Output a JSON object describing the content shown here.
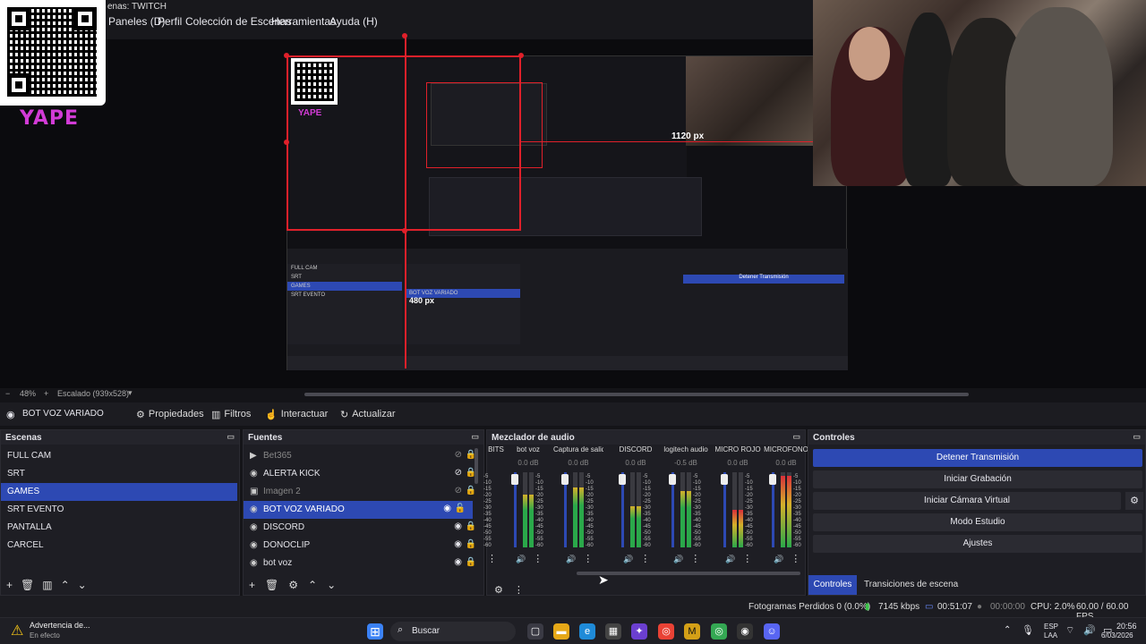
{
  "window": {
    "title": "enas: TWITCH"
  },
  "menu": [
    "Paneles (D)",
    "Perfil",
    "Colección de Escenas",
    "Herramientas",
    "Ayuda (H)"
  ],
  "overlay": {
    "yape_text": "YAPE"
  },
  "preview": {
    "dim_horizontal": "1120 px",
    "dim_inner": "480 px",
    "zoom": "48%",
    "scale": "Escalado (939x528)"
  },
  "source_toolbar": {
    "current_source": "BOT VOZ VARIADO",
    "properties": "Propiedades",
    "filters": "Filtros",
    "interact": "Interactuar",
    "refresh": "Actualizar"
  },
  "scenes": {
    "title": "Escenas",
    "items": [
      {
        "label": "FULL CAM",
        "selected": false
      },
      {
        "label": "SRT",
        "selected": false
      },
      {
        "label": "GAMES",
        "selected": true
      },
      {
        "label": "SRT EVENTO",
        "selected": false
      },
      {
        "label": "PANTALLA",
        "selected": false
      },
      {
        "label": "CARCEL",
        "selected": false
      }
    ]
  },
  "sources": {
    "title": "Fuentes",
    "items": [
      {
        "label": "Bet365",
        "icon": "play-icon",
        "visible": false,
        "selected": false
      },
      {
        "label": "ALERTA KICK",
        "icon": "globe-icon",
        "visible": true,
        "selected": false
      },
      {
        "label": "Imagen 2",
        "icon": "image-icon",
        "visible": false,
        "selected": false
      },
      {
        "label": "BOT VOZ VARIADO",
        "icon": "globe-icon",
        "visible": true,
        "selected": true
      },
      {
        "label": "DISCORD",
        "icon": "globe-icon",
        "visible": true,
        "selected": false
      },
      {
        "label": "DONOCLIP",
        "icon": "globe-icon",
        "visible": true,
        "selected": false
      },
      {
        "label": "bot voz",
        "icon": "globe-icon",
        "visible": true,
        "selected": false
      }
    ]
  },
  "mixer": {
    "title": "Mezclador de audio",
    "channels": [
      {
        "name": "BITS",
        "db": ""
      },
      {
        "name": "bot voz",
        "db": "0.0 dB"
      },
      {
        "name": "Captura de salida d",
        "db": "0.0 dB"
      },
      {
        "name": "DISCORD",
        "db": "0.0 dB"
      },
      {
        "name": "logitech audio",
        "db": "-0.5 dB"
      },
      {
        "name": "MICRO ROJO",
        "db": "0.0 dB"
      },
      {
        "name": "MICROFONO",
        "db": "0.0 dB"
      }
    ],
    "scale": [
      "-5",
      "-10",
      "-15",
      "-20",
      "-25",
      "-30",
      "-35",
      "-40",
      "-45",
      "-50",
      "-55",
      "-60"
    ]
  },
  "controls": {
    "title": "Controles",
    "stop_stream": "Detener Transmisión",
    "start_recording": "Iniciar Grabación",
    "virtual_cam": "Iniciar Cámara Virtual",
    "studio_mode": "Modo Estudio",
    "settings": "Ajustes",
    "tab_controls": "Controles",
    "tab_transitions": "Transiciones de escena"
  },
  "status": {
    "dropped": "Fotogramas Perdidos 0 (0.0%)",
    "bitrate": "7145 kbps",
    "stream_time": "00:51:07",
    "rec_time": "00:00:00",
    "cpu": "CPU: 2.0%",
    "fps": "60.00 / 60.00 FPS"
  },
  "taskbar": {
    "warning_title": "Advertencia de...",
    "warning_sub": "En efecto",
    "search": "Buscar",
    "lang": "ESP",
    "lang2": "LAA",
    "time": "20:56",
    "date": "6/03/2026"
  },
  "colors": {
    "accent": "#2d49b3",
    "guide": "#e0202a",
    "yape": "#d23bd6"
  }
}
